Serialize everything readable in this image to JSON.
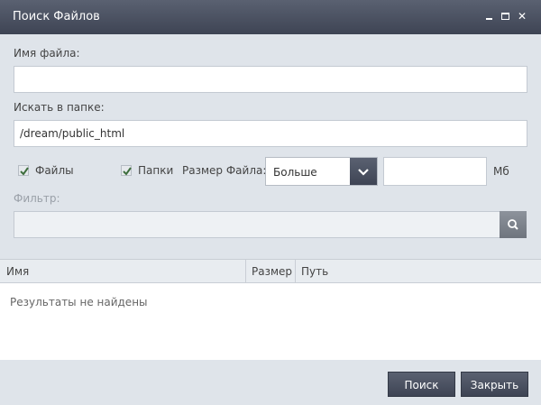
{
  "window": {
    "title": "Поиск Файлов",
    "controls": {
      "minimize": "minimize",
      "maximize": "maximize",
      "close": "✕"
    }
  },
  "form": {
    "filename_label": "Имя файла:",
    "filename_value": "",
    "folder_label": "Искать в папке:",
    "folder_value": "/dream/public_html",
    "files_checkbox": {
      "label": "Файлы",
      "checked": true
    },
    "folders_checkbox": {
      "label": "Папки",
      "checked": true
    },
    "size_label": "Размер Файла:",
    "size_option": "Больше",
    "size_value": "",
    "size_unit": "Мб",
    "filter_label": "Фильтр:",
    "filter_value": ""
  },
  "results": {
    "columns": [
      "Имя",
      "Размер",
      "Путь"
    ],
    "empty_text": "Результаты не найдены"
  },
  "buttons": {
    "search": "Поиск",
    "close": "Закрыть"
  },
  "colors": {
    "titlebar": "#4a5060",
    "background": "#dfe4ea",
    "button": "#4a5060",
    "checkmark": "#3d6e3d"
  }
}
